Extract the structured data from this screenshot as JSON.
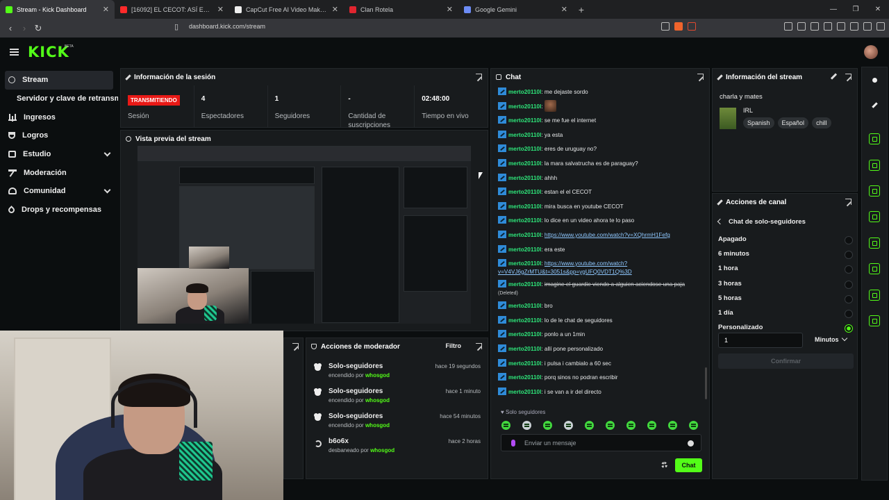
{
  "browser": {
    "tabs": [
      {
        "title": "Stream - Kick Dashboard",
        "fav": "#53fc18",
        "active": true
      },
      {
        "title": "[16092] EL CECOT: ASÍ ES EL INFIERNO",
        "fav": "#ff2a2a"
      },
      {
        "title": "CapCut Free AI Video Maker | Smart",
        "fav": "#eeeeee"
      },
      {
        "title": "Clan Rotela",
        "fav": "#e0252f"
      },
      {
        "title": "Google Gemini",
        "fav": "#6d8cf5"
      }
    ],
    "url": "dashboard.kick.com/stream"
  },
  "kick": {
    "logo": "KICK",
    "beta": "BETA"
  },
  "sidebar": {
    "items": [
      {
        "label": "Stream",
        "icon": "stream-icon"
      },
      {
        "label": "Servidor y clave de retransmisión",
        "icon": "none"
      },
      {
        "label": "Ingresos",
        "icon": "bar-chart-icon"
      },
      {
        "label": "Logros",
        "icon": "trophy-icon"
      },
      {
        "label": "Estudio",
        "icon": "film-icon"
      },
      {
        "label": "Moderación",
        "icon": "hammer-icon"
      },
      {
        "label": "Comunidad",
        "icon": "users-icon"
      },
      {
        "label": "Drops y recompensas",
        "icon": "drop-icon"
      }
    ]
  },
  "session": {
    "title": "Información de la sesión",
    "live_badge": "TRANSMITIENDO",
    "stats": [
      {
        "value": "",
        "label": "Sesión"
      },
      {
        "value": "4",
        "label": "Espectadores"
      },
      {
        "value": "1",
        "label": "Seguidores"
      },
      {
        "value": "-",
        "label": "Cantidad de suscripciones"
      },
      {
        "value": "02:48:00",
        "label": "Tiempo en vivo"
      }
    ]
  },
  "preview": {
    "title": "Vista previa del stream"
  },
  "mod": {
    "title": "Acciones de moderador",
    "filter": "Filtro",
    "rows": [
      {
        "title": "Solo-seguidores",
        "detail": "encendido por",
        "by": "whosgod",
        "when": "hace 19 segundos",
        "icon": "heart-icon"
      },
      {
        "title": "Solo-seguidores",
        "detail": "encendido por",
        "by": "whosgod",
        "when": "hace 1 minuto",
        "icon": "heart-icon"
      },
      {
        "title": "Solo-seguidores",
        "detail": "encendido por",
        "by": "whosgod",
        "when": "hace 54 minutos",
        "icon": "heart-icon"
      },
      {
        "title": "b6o6x",
        "detail": "desbaneado por",
        "by": "whosgod",
        "when": "hace 2 horas",
        "icon": "undo-icon"
      }
    ]
  },
  "chat": {
    "title": "Chat",
    "messages": [
      {
        "user": "merto20110l",
        "text": "me dejaste sordo"
      },
      {
        "user": "merto20110l",
        "text": "",
        "emote": true
      },
      {
        "user": "merto20110l",
        "text": "se me fue el internet"
      },
      {
        "user": "merto20110l",
        "text": "ya esta"
      },
      {
        "user": "merto20110l",
        "text": "eres de uruguay no?"
      },
      {
        "user": "merto20110l",
        "text": "la mara salvatrucha es de paraguay?"
      },
      {
        "user": "merto20110l",
        "text": "ahhh"
      },
      {
        "user": "merto20110l",
        "text": "estan el el CECOT"
      },
      {
        "user": "merto20110l",
        "text": "mira busca en youtube CECOT"
      },
      {
        "user": "merto20110l",
        "text": "lo dice en un video ahora te lo paso"
      },
      {
        "user": "merto20110l",
        "link": "https://www.youtube.com/watch?v=XQhrmH1Fefg"
      },
      {
        "user": "merto20110l",
        "text": "era este"
      },
      {
        "user": "merto20110l",
        "link": "https://www.youtube.com/watch?v=V4VJ6gZrMTU&t=3051s&pp=ygUFQ0VDT1Q%3D",
        "wrap": true
      },
      {
        "user": "merto20110l",
        "deleted_text": "imagine el guardie viendo a alguien aciendose una paja",
        "deleted_tag": "(Deleted)",
        "wrap": true
      },
      {
        "user": "merto20110l",
        "text": "bro"
      },
      {
        "user": "merto20110l",
        "text": "lo de le chat de seguidores"
      },
      {
        "user": "merto20110l",
        "text": "ponlo a un 1min"
      },
      {
        "user": "merto20110l",
        "text": "allí pone personalizado"
      },
      {
        "user": "merto20110l",
        "text": "i pulsa i cambialo a 60 sec"
      },
      {
        "user": "merto20110l",
        "text": "porq sinos no podran escribir"
      },
      {
        "user": "merto20110l",
        "text": "i se van a ir del directo"
      }
    ],
    "mode_label": "Solo seguidores",
    "input_placeholder": "Enviar un mensaje",
    "send_label": "Chat"
  },
  "stream_info": {
    "title": "Información del stream",
    "stream_title": "charla y mates",
    "category": "IRL",
    "tags": [
      "Spanish",
      "Español",
      "chill"
    ]
  },
  "channel": {
    "title": "Acciones de canal",
    "back_label": "Chat de solo-seguidores",
    "options": [
      "Apagado",
      "6 minutos",
      "1 hora",
      "3 horas",
      "5 horas",
      "1 día",
      "Personalizado"
    ],
    "selected": "Personalizado",
    "custom_value": "1",
    "unit": "Minutos",
    "confirm_label": "Confirmar"
  }
}
